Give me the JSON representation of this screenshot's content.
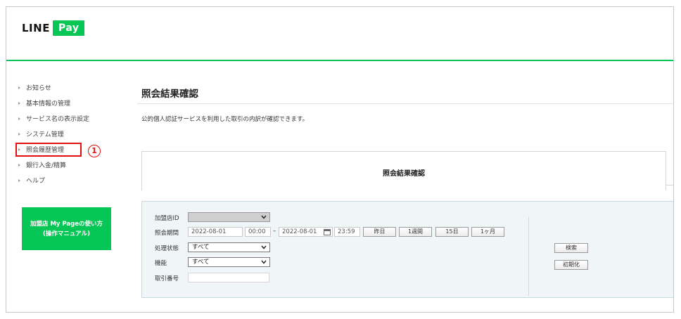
{
  "brand": {
    "line": "LINE",
    "pay": "Pay"
  },
  "sidebar": {
    "items": [
      {
        "label": "お知らせ"
      },
      {
        "label": "基本情報の管理"
      },
      {
        "label": "サービス名の表示設定"
      },
      {
        "label": "システム管理"
      },
      {
        "label": "照会履歴管理"
      },
      {
        "label": "銀行入金/精算"
      },
      {
        "label": "ヘルプ"
      }
    ],
    "marker": "1",
    "manual_line1": "加盟店 My Pageの使い方",
    "manual_line2": "(操作マニュアル)"
  },
  "main": {
    "title": "照会結果確認",
    "description": "公的個人認証サービスを利用した取引の内訳が確認できます。",
    "tab_title": "照会結果確認"
  },
  "search": {
    "merchant_id_label": "加盟店ID",
    "period_label": "照会期間",
    "start_date": "2022-08-01",
    "start_time": "00:00",
    "range_separator": "–",
    "end_date": "2022-08-01",
    "end_time": "23:59",
    "quick_buttons": [
      "昨日",
      "1週間",
      "15日",
      "1ヶ月"
    ],
    "status_label": "処理状態",
    "status_value": "すべて",
    "function_label": "機能",
    "function_value": "すべて",
    "txn_no_label": "取引番号",
    "search_button": "検索",
    "reset_button": "初期化"
  },
  "colors": {
    "brand_green": "#06c755",
    "marker_red": "#e01010"
  }
}
